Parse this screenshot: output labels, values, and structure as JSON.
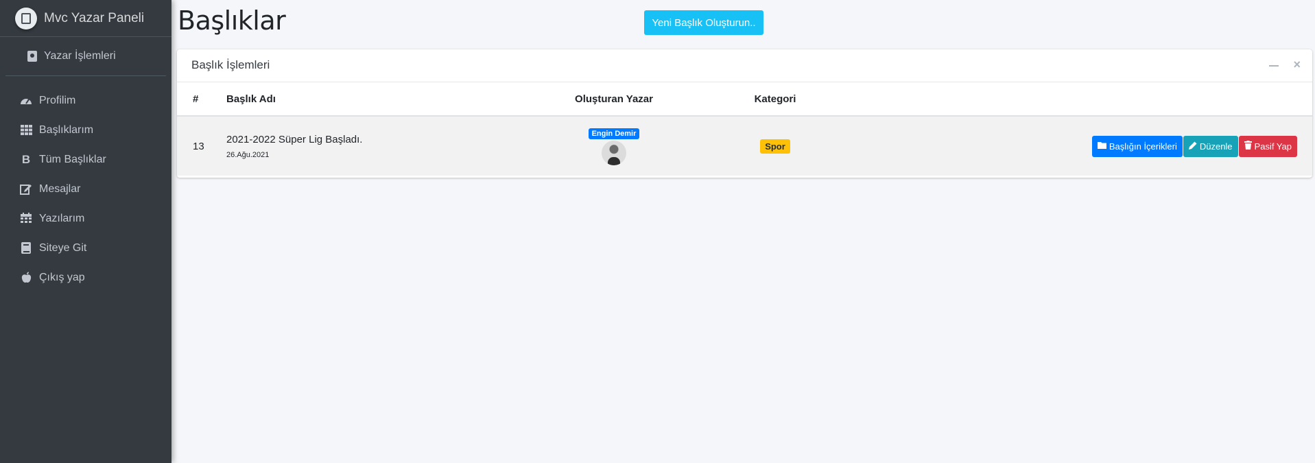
{
  "sidebar": {
    "brand": "Mvc Yazar Paneli",
    "user_panel": "Yazar İşlemleri",
    "items": [
      {
        "label": "Profilim",
        "icon": "speedometer-icon"
      },
      {
        "label": "Başlıklarım",
        "icon": "grid-icon"
      },
      {
        "label": "Tüm Başlıklar",
        "icon": "bold-b-icon"
      },
      {
        "label": "Mesajlar",
        "icon": "edit-icon"
      },
      {
        "label": "Yazılarım",
        "icon": "calendar-icon"
      },
      {
        "label": "Siteye Git",
        "icon": "book-icon"
      },
      {
        "label": "Çıkış yap",
        "icon": "apple-icon"
      }
    ]
  },
  "header": {
    "title": "Başlıklar",
    "new_button": "Yeni Başlık Oluşturun.."
  },
  "card": {
    "title": "Başlık İşlemleri",
    "columns": [
      "#",
      "Başlık Adı",
      "Oluşturan Yazar",
      "Kategori",
      ""
    ],
    "rows": [
      {
        "id": "13",
        "title": "2021-2022 Süper Lig Başladı.",
        "date": "26.Ağu.2021",
        "author": "Engin Demir",
        "category": "Spor",
        "actions": {
          "contents": "Başlığın İçerikleri",
          "edit": "Düzenle",
          "deactivate": "Pasif Yap"
        }
      }
    ]
  },
  "colors": {
    "sidebar_bg": "#343a40",
    "new_button": "#17c1f6",
    "primary": "#007bff",
    "info": "#17a2b8",
    "danger": "#dc3545",
    "warning": "#ffc107"
  }
}
